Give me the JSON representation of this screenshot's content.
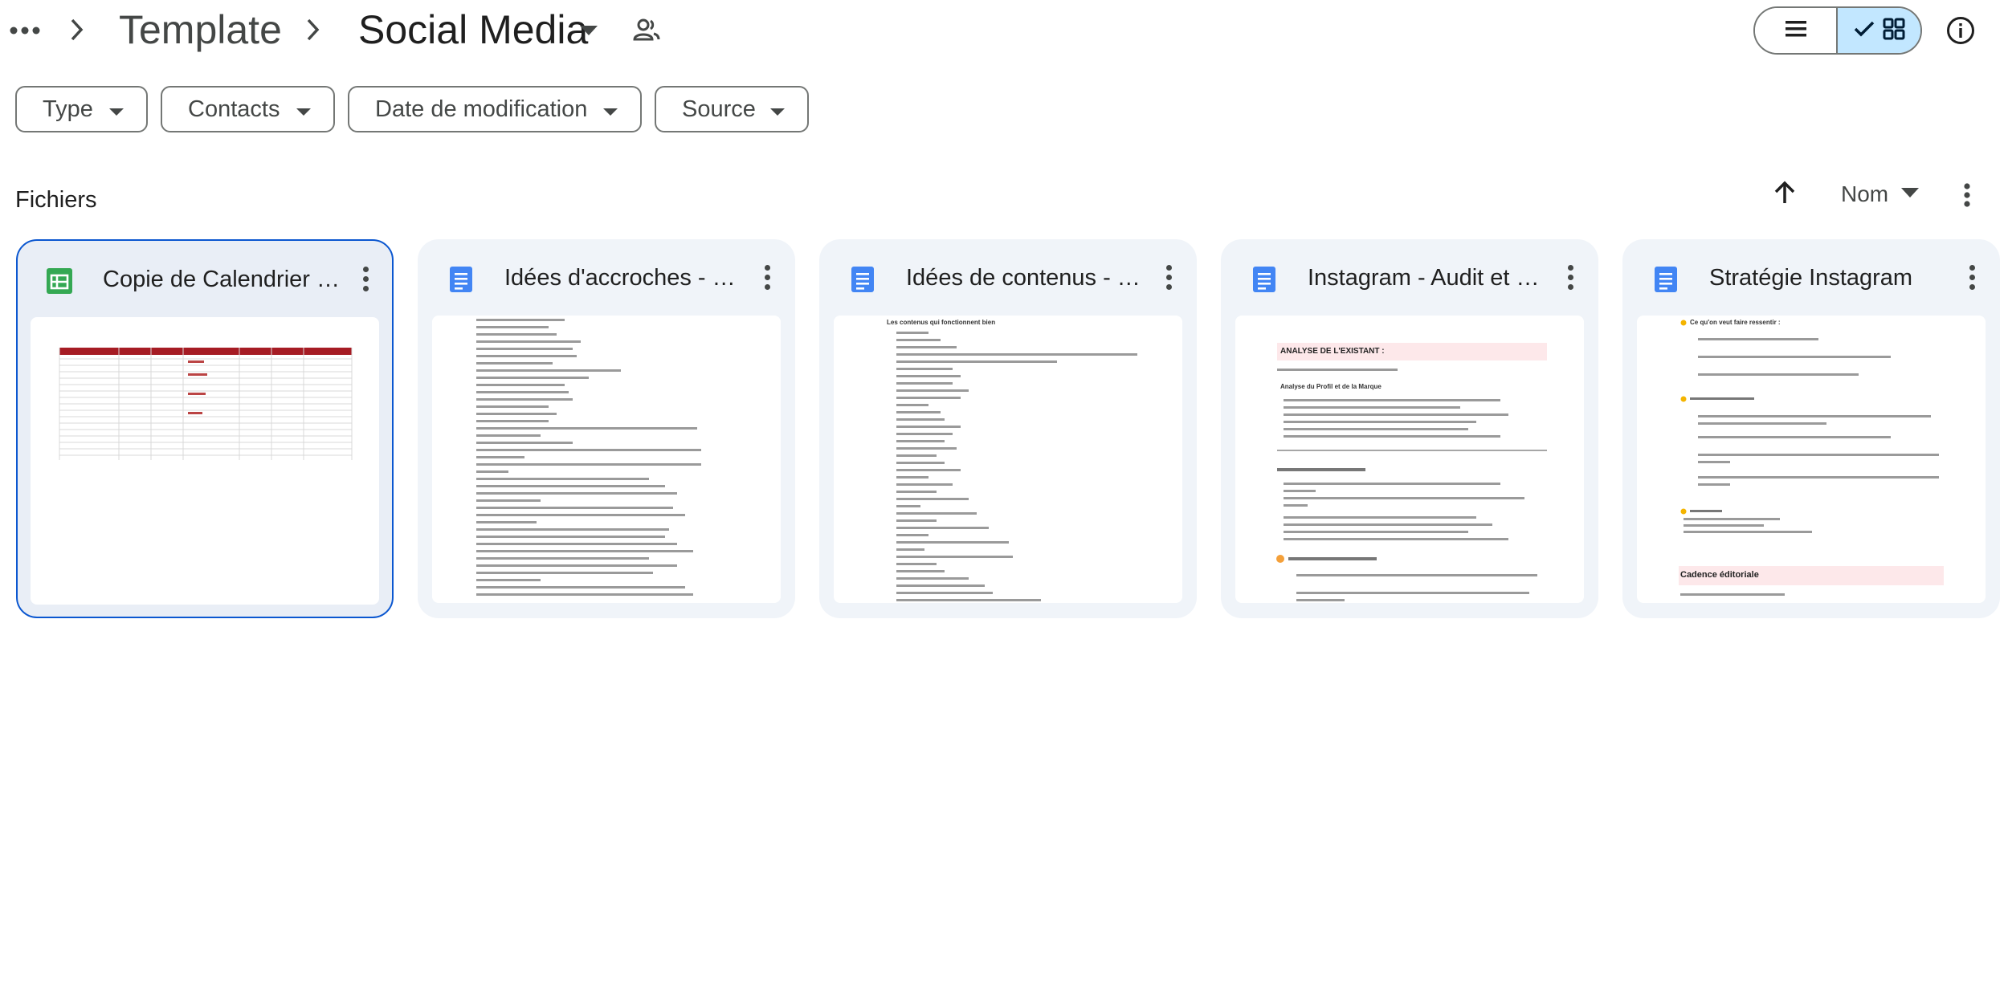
{
  "breadcrumb": {
    "parent": "Template",
    "current": "Social Media"
  },
  "filters": [
    {
      "label": "Type"
    },
    {
      "label": "Contacts"
    },
    {
      "label": "Date de modification"
    },
    {
      "label": "Source"
    }
  ],
  "section": {
    "title": "Fichiers",
    "sort_label": "Nom"
  },
  "colors": {
    "accent": "#0b57d0",
    "sheets_green": "#34a853",
    "docs_blue": "#4285f4",
    "toggle_active": "#c2e7ff",
    "card_bg": "#f0f4f9",
    "sheet_header": "#a61c24"
  },
  "icons": [
    "more-horiz-icon",
    "chevron-right-icon",
    "arrow-drop-down-icon",
    "shared-folder-icon",
    "list-view-icon",
    "check-icon",
    "grid-view-icon",
    "info-icon",
    "arrow-upward-icon",
    "more-vert-icon",
    "google-sheets-icon",
    "google-docs-icon"
  ],
  "files": [
    {
      "title": "Copie de Calendrier éditorial",
      "type": "sheet",
      "selected": true
    },
    {
      "title": "Idées d'accroches - Social Media",
      "type": "doc",
      "selected": false
    },
    {
      "title": "Idées de contenus - Social Media",
      "type": "doc",
      "selected": false
    },
    {
      "title": "Instagram - Audit et analyse",
      "type": "doc",
      "selected": false
    },
    {
      "title": "Stratégie Instagram",
      "type": "doc",
      "selected": false
    }
  ],
  "previews": {
    "file3_heading": "Les contenus qui fonctionnent bien",
    "file4_heading": "ANALYSE DE L'EXISTANT :",
    "file4_section": "Analyse du Profil et de la Marque",
    "file5_heading": "Ce qu'on veut faire ressentir :",
    "file5_section": "Cadence éditoriale"
  }
}
